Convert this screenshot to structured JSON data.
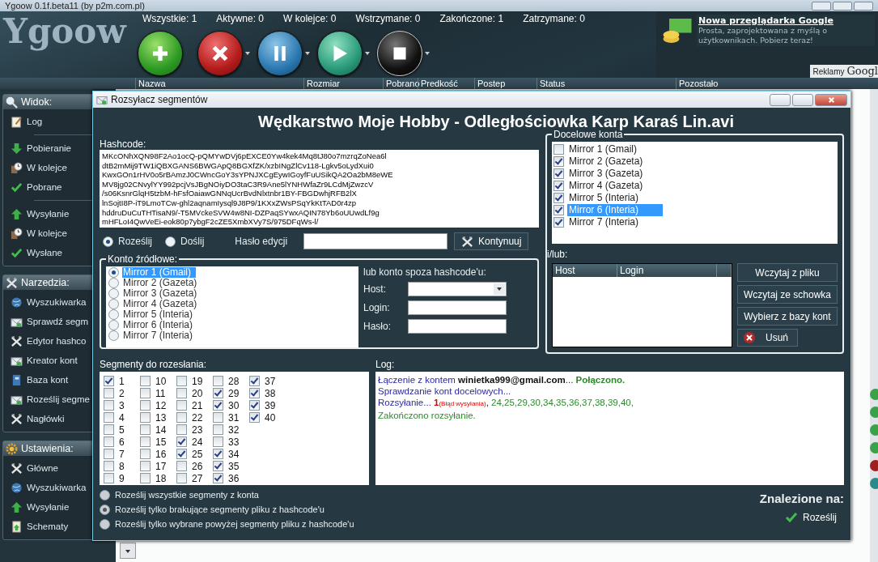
{
  "window": {
    "title": "Ygoow 0.1f.beta11 (by p2m.com.pl)"
  },
  "logo": "Ygoow",
  "stats": [
    "Wszystkie: 1",
    "Aktywne: 0",
    "W kolejce: 0",
    "Wstrzymane: 0",
    "Zakończone: 1",
    "Zatrzymane: 0"
  ],
  "toolbar": [
    {
      "kind": "add",
      "has_menu": false
    },
    {
      "kind": "remove",
      "has_menu": true
    },
    {
      "kind": "pause",
      "has_menu": true
    },
    {
      "kind": "play",
      "has_menu": true
    },
    {
      "kind": "stop",
      "has_menu": true
    }
  ],
  "ad": {
    "headline": "Nowa przeglądarka Google",
    "text": "Prosta, zaprojektowana z myślą o użytkownikach. Pobierz teraz!",
    "footer_label": "Reklamy",
    "footer_brand": "Googl"
  },
  "columns": [
    "Nazwa",
    "Rozmiar",
    "Pobrano",
    "Predkość",
    "Postep",
    "Status",
    "Pozostało"
  ],
  "sidebar": [
    {
      "title": "Widok:",
      "groups": [
        [
          "Log"
        ],
        [
          "Pobieranie",
          "W kolejce",
          "Pobrane"
        ],
        [
          "Wysyłanie",
          "W kolejce",
          "Wysłane"
        ]
      ]
    },
    {
      "title": "Narzedzia:",
      "groups": [
        [
          "Wyszukiwarka",
          "Sprawdź segm",
          "Edytor hashco",
          "Kreator kont",
          "Baza kont",
          "Roześlij segme",
          "Nagłówki"
        ]
      ]
    },
    {
      "title": "Ustawienia:",
      "groups": [
        [
          "Główne",
          "Wyszukiwarka",
          "Wysyłanie",
          "Schematy"
        ]
      ]
    }
  ],
  "dialog": {
    "title": "Rozsyłacz segmentów",
    "file_title": "Wędkarstwo Moje Hobby - Odległościowka Karp Karaś Lin.avi",
    "hashcode_label": "Hashcode:",
    "hashcode_lines": [
      "MKcONhXQN98F2Ao1ocQ-pQMYwDVj6pEXCE0Yw4kek4Mq8tJ80o7mzrqZoNea6l",
      "dtB2mMij9TW1iQBXGANS6BWGApQ8BGXfZK/xzbINgZlCv118-Lgkv5oLydXui0",
      "KwxGOn1rHV0o5rBAmzJ0CWncGoY3sYPNJXCgEywIGoyfFuUSikQA2Oa2bM8eWE",
      "MV8jg02CNvylYY992pcjVsJBgNOiyDO3taC3R9Ane5lYNHWfaZr9LCdMjZwzcV",
      "/s06KsnrGlqH5tzbM-hFsfOaiawGNNqUcrBvdNlxtnbr1BY-FBGDwhjRFB2lX",
      "lnSojtI8P-iT9LmoTCw-ghl2aqnamIysql9J8P9/1KXxZWsPSqYkKtTAD0r4zp",
      "hddruDuCuTHTisaN9/-T5MVckeSVW4w8NI-DZPaqSYwxAQIN78Yb6oUUwdLf9g",
      "mHFLoI4QwVeEi-eok80p7ybgF2cZE5XmbXVy7S/975DFqWs-l/"
    ],
    "modes": [
      {
        "label": "Roześlij",
        "selected": true
      },
      {
        "label": "Doślij",
        "selected": false
      }
    ],
    "edit_password_label": "Hasło edycji",
    "continue_button": "Kontynuuj",
    "source": {
      "title": "Konto źródłowe:",
      "accounts": [
        {
          "label": "Mirror 1 (Gmail)",
          "selected": true
        },
        {
          "label": "Mirror 2 (Gazeta)",
          "selected": false
        },
        {
          "label": "Mirror 3 (Gazeta)",
          "selected": false
        },
        {
          "label": "Mirror 4 (Gazeta)",
          "selected": false
        },
        {
          "label": "Mirror 5 (Interia)",
          "selected": false
        },
        {
          "label": "Mirror 6 (Interia)",
          "selected": false
        },
        {
          "label": "Mirror 7 (Interia)",
          "selected": false
        }
      ],
      "other_label": "lub konto spoza hashcode'u:",
      "fields": [
        {
          "label": "Host:",
          "kind": "select"
        },
        {
          "label": "Login:",
          "kind": "text"
        },
        {
          "label": "Hasło:",
          "kind": "text"
        }
      ]
    },
    "targets": {
      "title": "Docelowe konta",
      "accounts": [
        {
          "label": "Mirror 1 (Gmail)",
          "checked": false,
          "selected": false
        },
        {
          "label": "Mirror 2 (Gazeta)",
          "checked": true,
          "selected": false
        },
        {
          "label": "Mirror 3 (Gazeta)",
          "checked": true,
          "selected": false
        },
        {
          "label": "Mirror 4 (Gazeta)",
          "checked": true,
          "selected": false
        },
        {
          "label": "Mirror 5 (Interia)",
          "checked": true,
          "selected": false
        },
        {
          "label": "Mirror 6 (Interia)",
          "checked": true,
          "selected": true
        },
        {
          "label": "Mirror 7 (Interia)",
          "checked": true,
          "selected": false
        }
      ],
      "or_label": "i/lub:",
      "columns": [
        "Host",
        "Login"
      ],
      "buttons": [
        "Wczytaj z pliku",
        "Wczytaj ze schowka",
        "Wybierz z bazy kont"
      ],
      "remove_button": "Usuń"
    },
    "segments": {
      "title": "Segmenty do rozesłania:",
      "items": [
        {
          "label": "1",
          "checked": true
        },
        {
          "label": "2",
          "checked": false
        },
        {
          "label": "3",
          "checked": false
        },
        {
          "label": "4",
          "checked": false
        },
        {
          "label": "5",
          "checked": false
        },
        {
          "label": "6",
          "checked": false
        },
        {
          "label": "7",
          "checked": false
        },
        {
          "label": "8",
          "checked": false
        },
        {
          "label": "9",
          "checked": false
        },
        {
          "label": "10",
          "checked": false
        },
        {
          "label": "11",
          "checked": false
        },
        {
          "label": "12",
          "checked": false
        },
        {
          "label": "13",
          "checked": false
        },
        {
          "label": "14",
          "checked": false
        },
        {
          "label": "15",
          "checked": false
        },
        {
          "label": "16",
          "checked": false
        },
        {
          "label": "17",
          "checked": false
        },
        {
          "label": "18",
          "checked": false
        },
        {
          "label": "19",
          "checked": false
        },
        {
          "label": "20",
          "checked": false
        },
        {
          "label": "21",
          "checked": false
        },
        {
          "label": "22",
          "checked": false
        },
        {
          "label": "23",
          "checked": false
        },
        {
          "label": "24",
          "checked": true
        },
        {
          "label": "25",
          "checked": true
        },
        {
          "label": "26",
          "checked": false
        },
        {
          "label": "27",
          "checked": false
        },
        {
          "label": "28",
          "checked": false
        },
        {
          "label": "29",
          "checked": true
        },
        {
          "label": "30",
          "checked": true
        },
        {
          "label": "31",
          "checked": false
        },
        {
          "label": "32",
          "checked": false
        },
        {
          "label": "33",
          "checked": false
        },
        {
          "label": "34",
          "checked": true
        },
        {
          "label": "35",
          "checked": true
        },
        {
          "label": "36",
          "checked": true
        },
        {
          "label": "37",
          "checked": true
        },
        {
          "label": "38",
          "checked": true
        },
        {
          "label": "39",
          "checked": true
        },
        {
          "label": "40",
          "checked": true
        }
      ]
    },
    "send_options": [
      {
        "label": "Roześlij wszystkie segmenty z konta",
        "selected": false
      },
      {
        "label": "Roześlij tylko brakujące segmenty pliku z hashcode'u",
        "selected": true
      },
      {
        "label": "Roześlij tylko wybrane powyżej segmenty pliku z hashcode'u",
        "selected": false
      }
    ],
    "log": {
      "title": "Log:",
      "lines": [
        [
          {
            "text": "Łączenie z kontem ",
            "kind": "info"
          },
          {
            "text": "winietka999@gmail.com",
            "kind": "account"
          },
          {
            "text": "... ",
            "kind": "plain"
          },
          {
            "text": "Połączono.",
            "kind": "ok"
          }
        ],
        [
          {
            "text": "Sprawdzanie kont docelowych...",
            "kind": "info"
          }
        ],
        [
          {
            "text": "Rozsyłanie... ",
            "kind": "info"
          },
          {
            "text": "1",
            "kind": "error"
          },
          {
            "text": "(Błąd wysyłania)",
            "kind": "error-note"
          },
          {
            "text": ", ",
            "kind": "plain"
          },
          {
            "text": "24,25,29,30,34,35,36,37,38,39,40,",
            "kind": "done"
          }
        ],
        [
          {
            "text": "Zakończono rozsyłanie.",
            "kind": "done"
          }
        ]
      ]
    },
    "found_label": "Znalezione na:",
    "send_button": "Roześlij"
  }
}
